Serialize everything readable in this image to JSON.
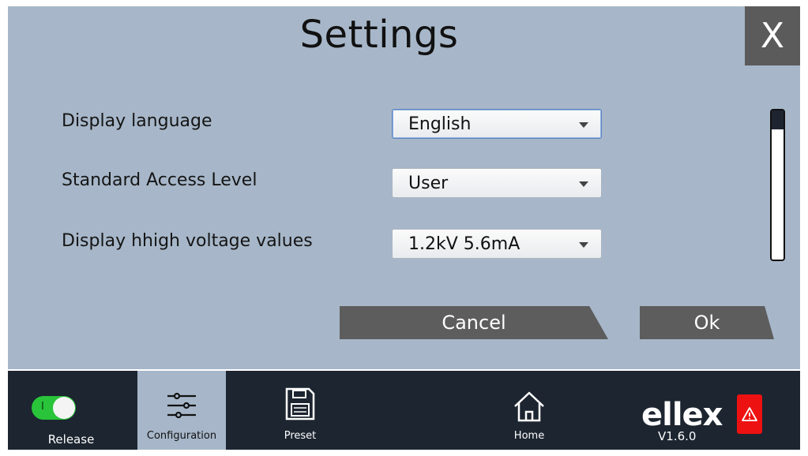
{
  "dialog": {
    "title": "Settings",
    "close_label": "X",
    "settings": [
      {
        "label": "Display language",
        "value": "English"
      },
      {
        "label": "Standard Access Level",
        "value": "User"
      },
      {
        "label": "Display hhigh voltage values",
        "value": "1.2kV 5.6mA"
      }
    ],
    "cancel_label": "Cancel",
    "ok_label": "Ok"
  },
  "taskbar": {
    "release_label": "Release",
    "toggle_text": "I",
    "configuration_label": "Configuration",
    "preset_label": "Preset",
    "home_label": "Home",
    "logo_text": "ellex",
    "version": "V1.6.0"
  },
  "colors": {
    "panel_bg": "#a7b7c9",
    "taskbar_bg": "#1c2530",
    "button_bg": "#5d5d5d",
    "toggle_on": "#29c43a",
    "warning": "#ee1111"
  }
}
